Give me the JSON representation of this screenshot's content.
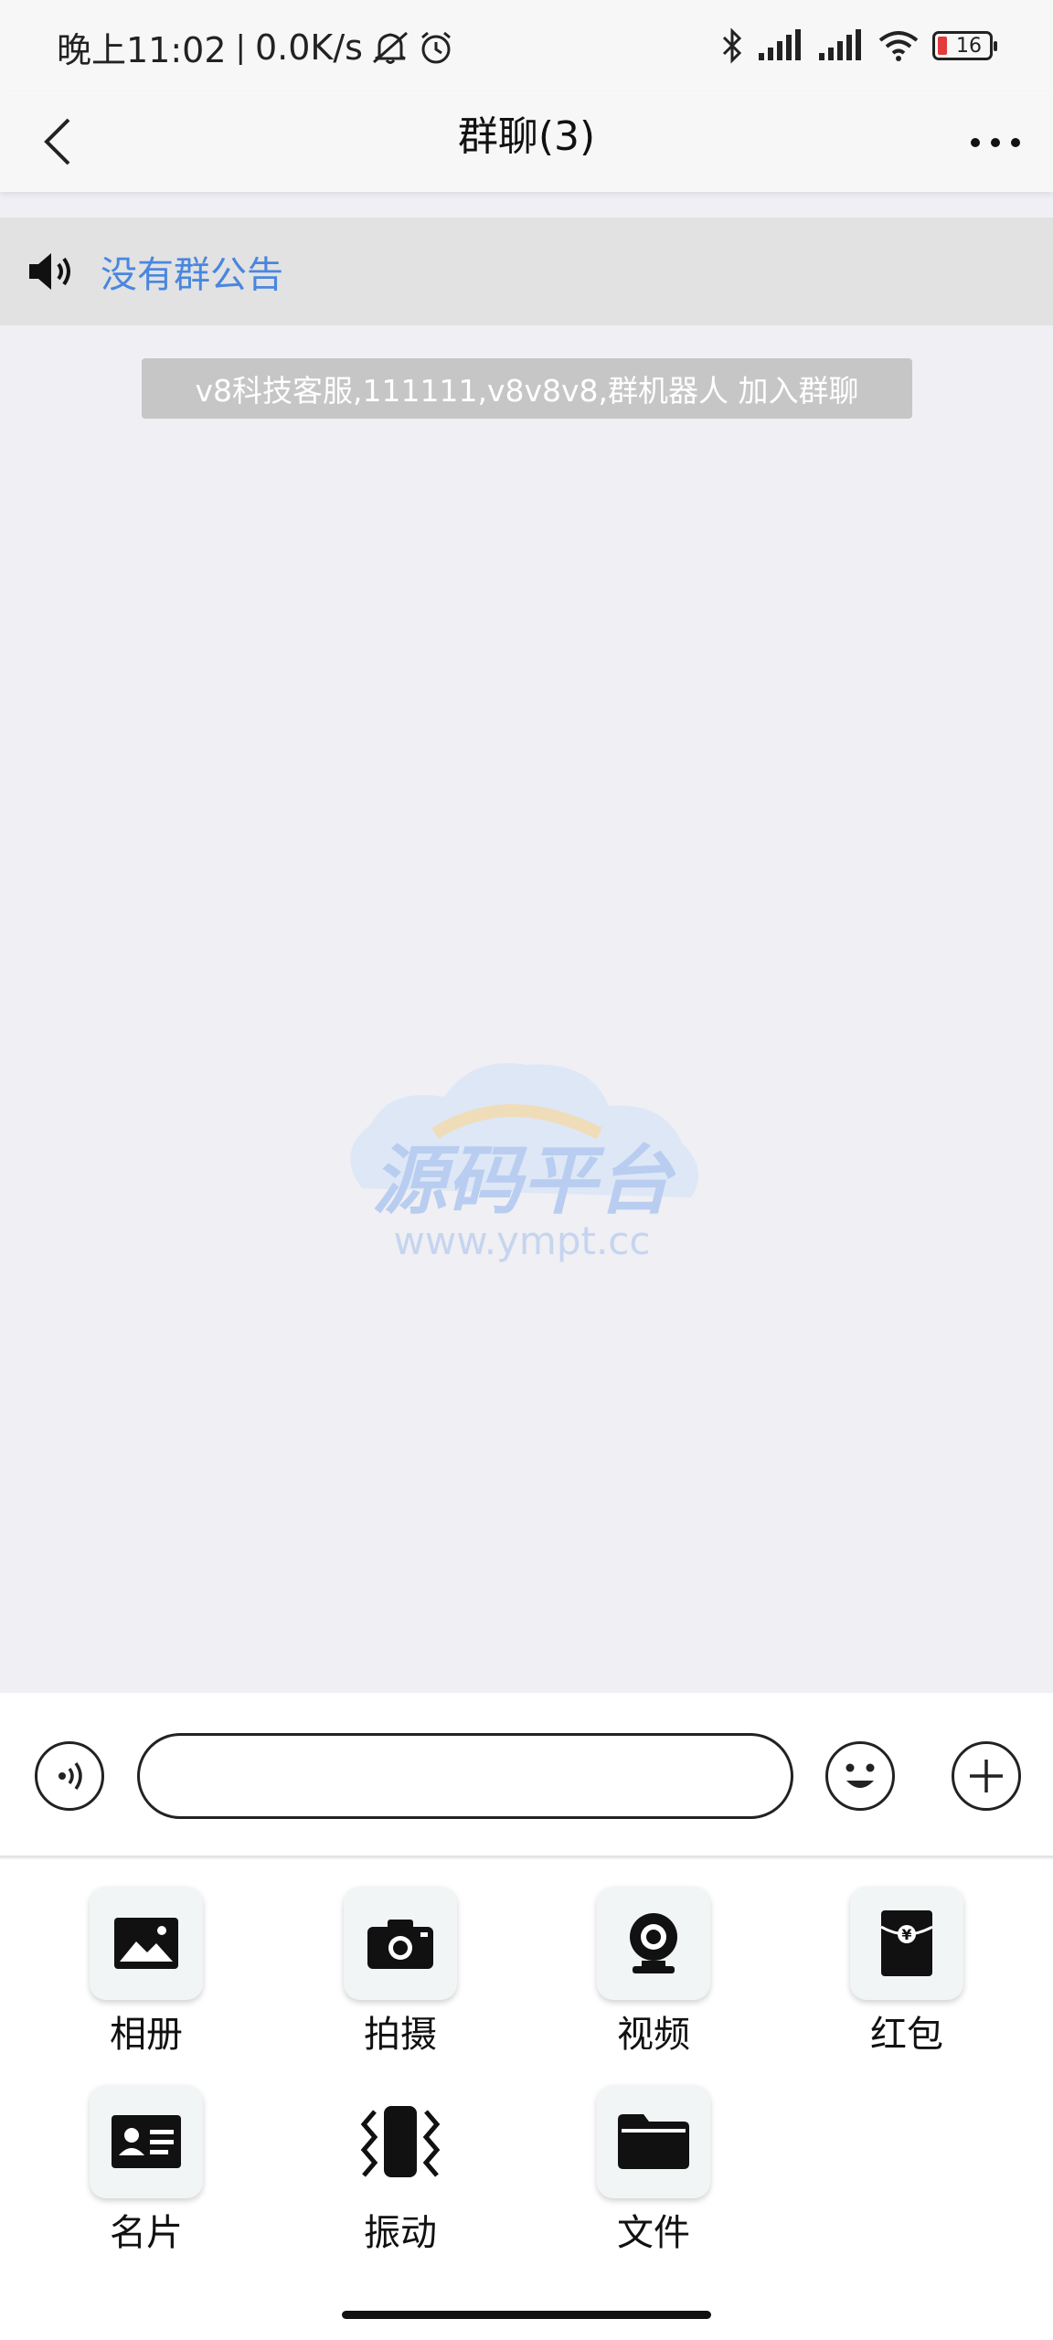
{
  "status_bar": {
    "time": "晚上11:02",
    "net_speed": "0.0K/s",
    "battery": "16"
  },
  "nav": {
    "title": "群聊(3)"
  },
  "notice": {
    "text": "没有群公告"
  },
  "messages": {
    "system": "v8科技客服,111111,v8v8v8,群机器人 加入群聊"
  },
  "watermark": {
    "title": "源码平台",
    "url": "www.ympt.cc"
  },
  "input": {
    "placeholder": ""
  },
  "tools": {
    "items": [
      {
        "label": "相册",
        "icon": "photo-album-icon"
      },
      {
        "label": "拍摄",
        "icon": "camera-icon"
      },
      {
        "label": "视频",
        "icon": "webcam-icon"
      },
      {
        "label": "红包",
        "icon": "red-packet-icon"
      },
      {
        "label": "名片",
        "icon": "contact-card-icon"
      },
      {
        "label": "振动",
        "icon": "vibrate-icon"
      },
      {
        "label": "文件",
        "icon": "folder-icon"
      }
    ]
  },
  "colors": {
    "notice_text": "#4a86e0",
    "system_msg_bg": "#c6c6c6",
    "chat_bg": "#efeff4"
  }
}
